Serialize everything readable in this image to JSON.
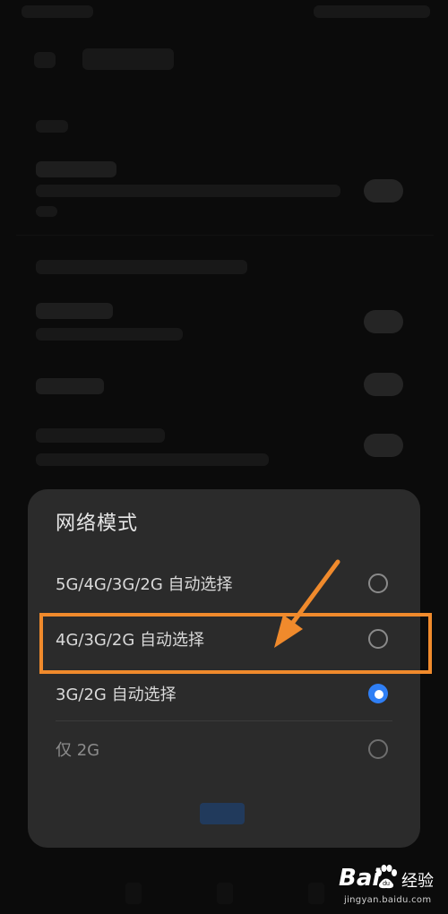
{
  "dialog": {
    "title": "网络模式",
    "options": [
      {
        "label": "5G/4G/3G/2G 自动选择",
        "selected": false,
        "disabled": false
      },
      {
        "label": "4G/3G/2G 自动选择",
        "selected": false,
        "disabled": false
      },
      {
        "label": "3G/2G 自动选择",
        "selected": true,
        "disabled": false
      },
      {
        "label": "仅 2G",
        "selected": false,
        "disabled": true
      }
    ]
  },
  "colors": {
    "accent": "#2f7ff5",
    "annotation": "#f08a2c",
    "dialog_bg": "#2b2b2b"
  },
  "watermark": {
    "logo": "Bai",
    "paw": "du",
    "name": "经验",
    "url": "jingyan.baidu.com"
  },
  "icons": [
    "back-arrow-icon",
    "paw-icon"
  ]
}
